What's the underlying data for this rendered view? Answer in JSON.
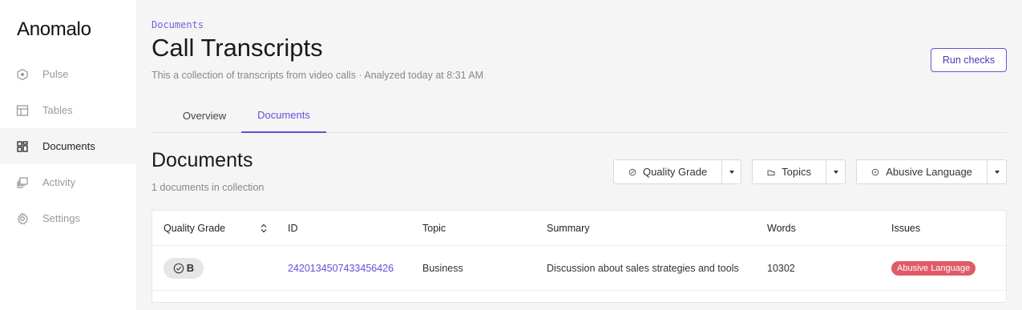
{
  "app": {
    "name": "Anomalo"
  },
  "sidebar": {
    "items": [
      {
        "label": "Pulse",
        "icon": "pulse-icon",
        "active": false
      },
      {
        "label": "Tables",
        "icon": "table-icon",
        "active": false
      },
      {
        "label": "Documents",
        "icon": "documents-icon",
        "active": true
      },
      {
        "label": "Activity",
        "icon": "activity-icon",
        "active": false
      },
      {
        "label": "Settings",
        "icon": "gear-icon",
        "active": false
      }
    ]
  },
  "header": {
    "breadcrumb": "Documents",
    "title": "Call Transcripts",
    "subtitle": "This a collection of transcripts from video calls · Analyzed today at 8:31 AM",
    "run_checks_label": "Run checks"
  },
  "tabs": [
    {
      "label": "Overview",
      "active": false
    },
    {
      "label": "Documents",
      "active": true
    }
  ],
  "section": {
    "title": "Documents",
    "count_text": "1 documents in collection"
  },
  "filters": [
    {
      "label": "Quality Grade",
      "icon": "grade-filter-icon"
    },
    {
      "label": "Topics",
      "icon": "tag-icon"
    },
    {
      "label": "Abusive Language",
      "icon": "warning-circle-icon"
    }
  ],
  "table": {
    "columns": [
      "Quality Grade",
      "ID",
      "Topic",
      "Summary",
      "Words",
      "Issues"
    ],
    "rows": [
      {
        "grade": "B",
        "id": "2420134507433456426",
        "topic": "Business",
        "summary": "Discussion about sales strategies and tools",
        "words": "10302",
        "issues": [
          "Abusive Language"
        ]
      }
    ]
  },
  "colors": {
    "accent": "#6a4cdb",
    "issue_badge": "#e05b66",
    "background": "#f5f5f5"
  }
}
